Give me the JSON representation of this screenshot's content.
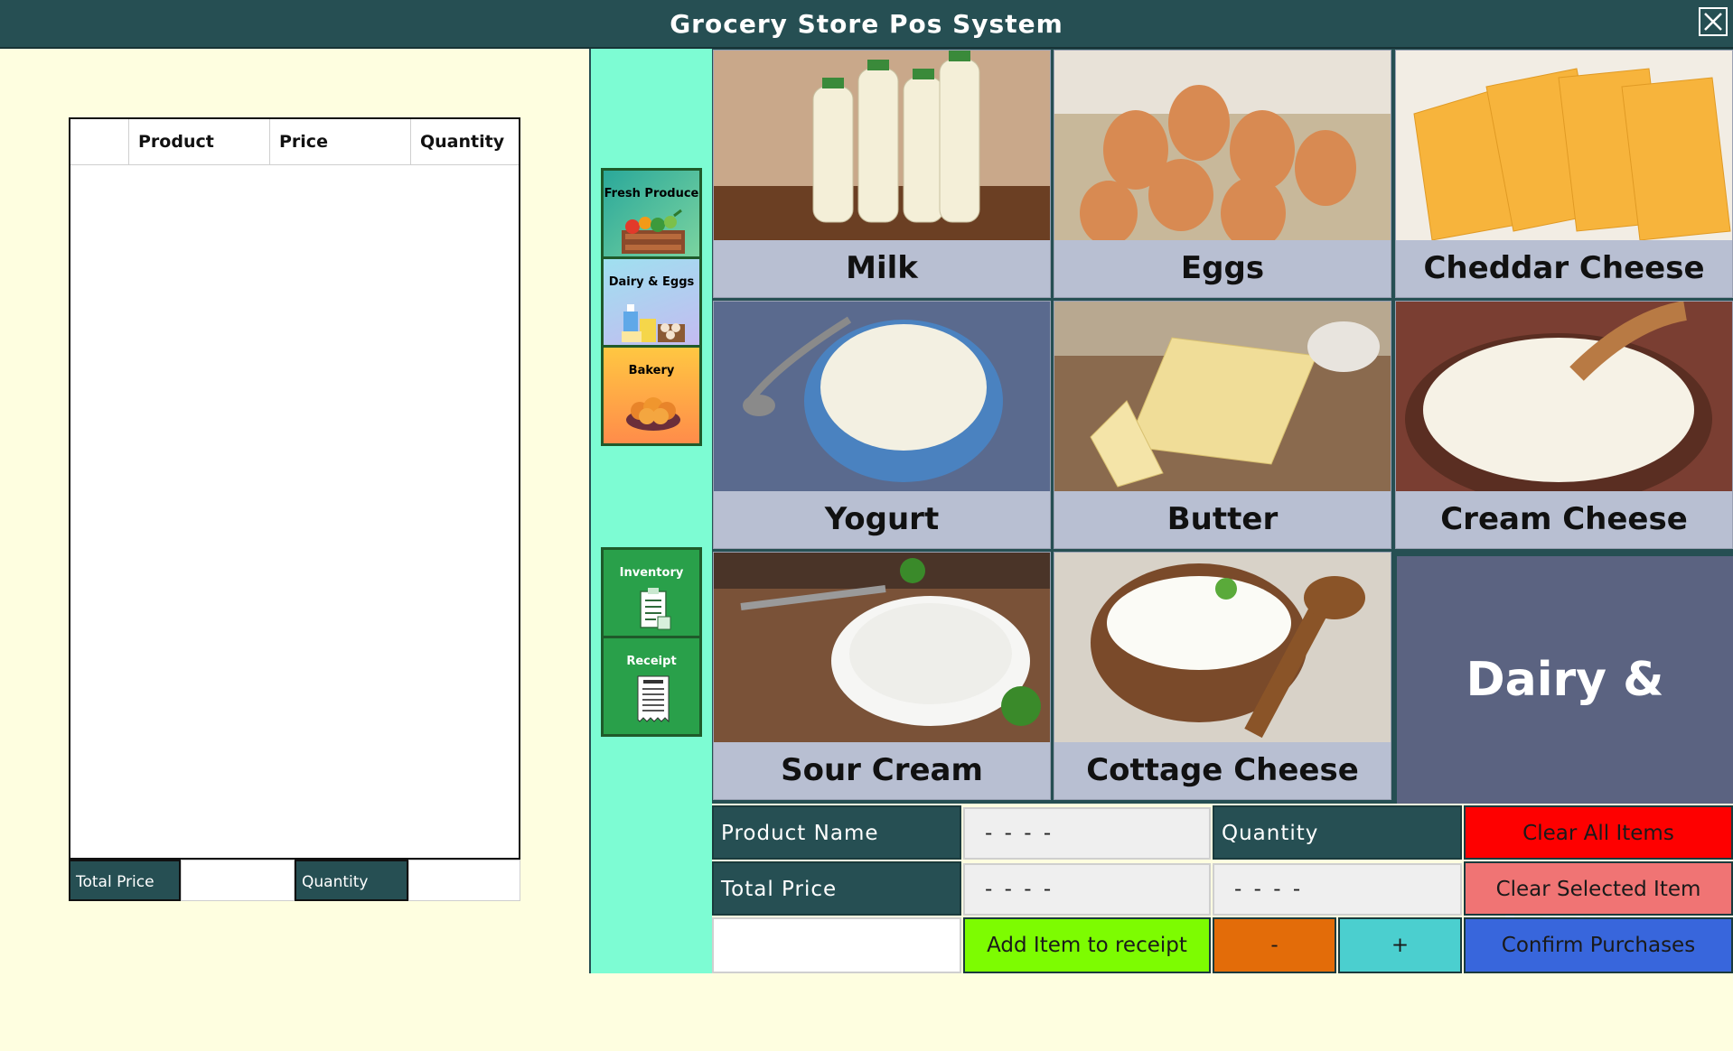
{
  "window": {
    "title": "Grocery Store Pos System"
  },
  "receipt": {
    "columns": [
      "",
      "Product",
      "Price",
      "Quantity"
    ],
    "total_price_label": "Total Price",
    "quantity_label": "Quantity",
    "total_price_value": "",
    "quantity_value": ""
  },
  "categories": [
    {
      "label": "Fresh Produce",
      "icon": "produce-crate-icon",
      "color": "#2aa89a"
    },
    {
      "label": "Dairy & Eggs",
      "icon": "dairy-eggs-icon",
      "color": "#5aa8d8"
    },
    {
      "label": "Bakery",
      "icon": "bread-basket-icon",
      "color": "#f7a440"
    }
  ],
  "tools": [
    {
      "label": "Inventory",
      "icon": "clipboard-icon"
    },
    {
      "label": "Receipt",
      "icon": "receipt-icon"
    }
  ],
  "products": [
    {
      "name": "Milk",
      "image": "milk-photo"
    },
    {
      "name": "Eggs",
      "image": "eggs-photo"
    },
    {
      "name": "Cheddar Cheese",
      "image": "cheddar-photo"
    },
    {
      "name": "Yogurt",
      "image": "yogurt-photo"
    },
    {
      "name": "Butter",
      "image": "butter-photo"
    },
    {
      "name": "Cream Cheese",
      "image": "cream-cheese-photo"
    },
    {
      "name": "Sour Cream",
      "image": "sour-cream-photo"
    },
    {
      "name": "Cottage Cheese",
      "image": "cottage-cheese-photo"
    }
  ],
  "current_category": "Dairy & Eggs",
  "controls": {
    "product_name_label": "Product Name",
    "product_name_value": "- - - -",
    "quantity_label": "Quantity",
    "total_price_label": "Total Price",
    "total_price_value": "- - - -",
    "quantity_value": "- - - -",
    "clear_all": "Clear All Items",
    "clear_selected": "Clear Selected Item",
    "add_item": "Add Item to receipt",
    "minus": "-",
    "plus": "+",
    "confirm": "Confirm Purchases"
  },
  "colors": {
    "header": "#264f53",
    "clear_all": "#fe0000",
    "clear_selected": "#f07474",
    "add_item": "#7dfc01",
    "minus": "#e36c09",
    "plus": "#4bcfcf",
    "confirm": "#3866dc"
  }
}
